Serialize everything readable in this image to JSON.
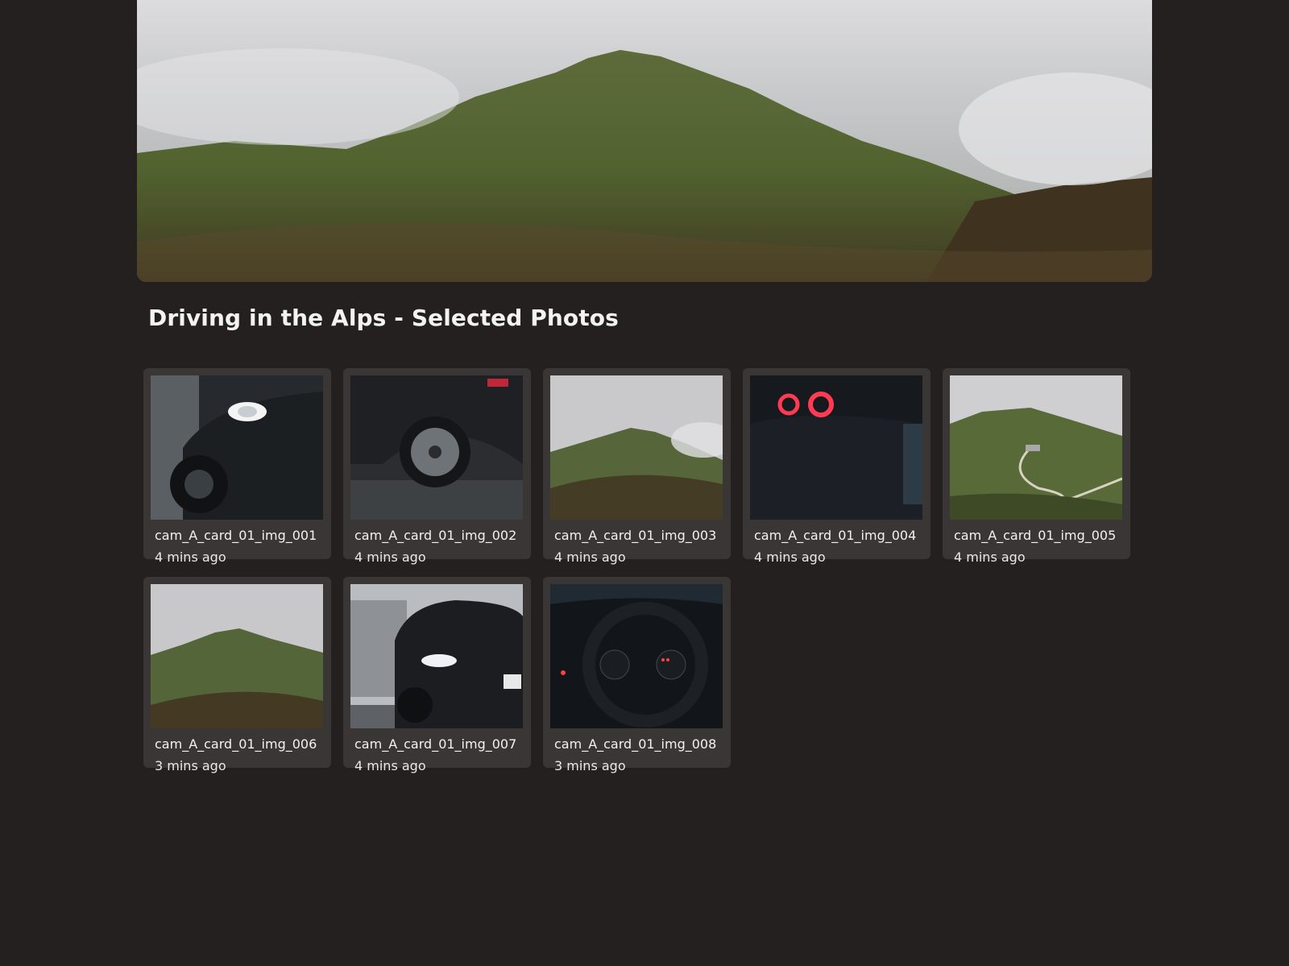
{
  "gallery": {
    "title": "Driving in the Alps - Selected Photos",
    "hero": {
      "subject": "misty-mountain"
    },
    "cards": [
      {
        "name": "cam_A_card_01_img_001",
        "time": "4 mins ago",
        "subject": "car-headlight"
      },
      {
        "name": "cam_A_card_01_img_002",
        "time": "4 mins ago",
        "subject": "car-wheel"
      },
      {
        "name": "cam_A_card_01_img_003",
        "time": "4 mins ago",
        "subject": "mountain"
      },
      {
        "name": "cam_A_card_01_img_004",
        "time": "4 mins ago",
        "subject": "car-taillight"
      },
      {
        "name": "cam_A_card_01_img_005",
        "time": "4 mins ago",
        "subject": "mountain-road"
      },
      {
        "name": "cam_A_card_01_img_006",
        "time": "3 mins ago",
        "subject": "mountain"
      },
      {
        "name": "cam_A_card_01_img_007",
        "time": "4 mins ago",
        "subject": "car-front"
      },
      {
        "name": "cam_A_card_01_img_008",
        "time": "3 mins ago",
        "subject": "dashboard"
      }
    ]
  },
  "colors": {
    "background": "#242020",
    "card": "#3a3636",
    "text": "#f2f2f2"
  }
}
